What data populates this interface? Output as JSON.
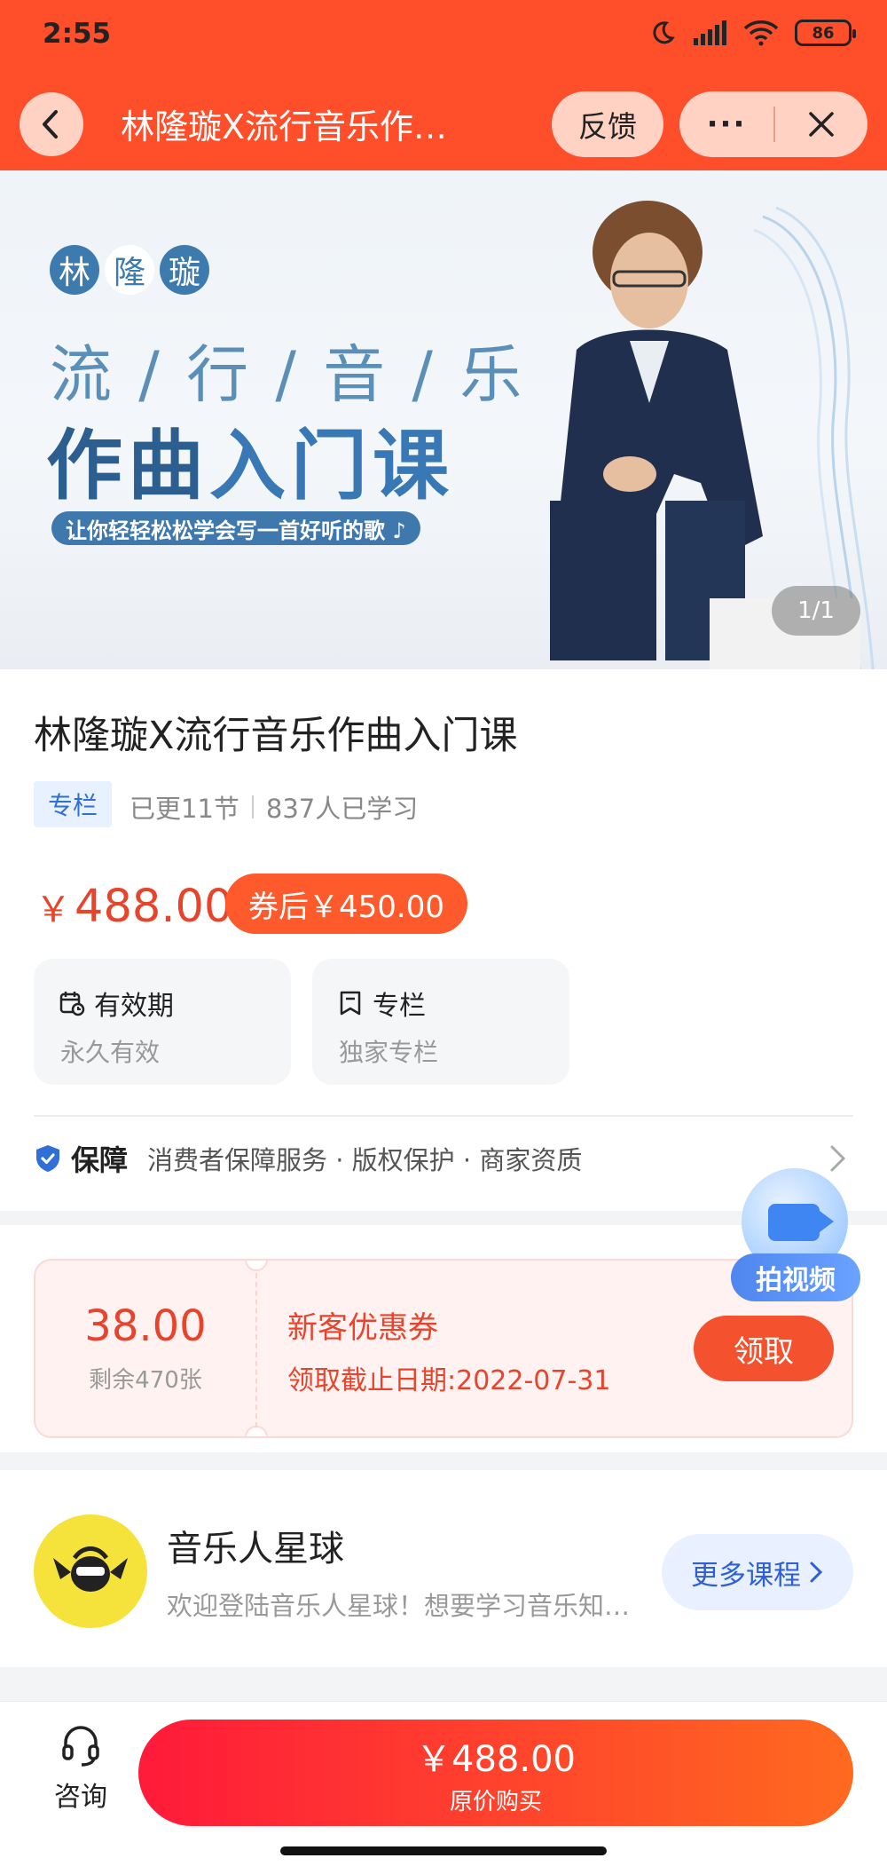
{
  "status_bar": {
    "time": "2:55",
    "battery": "86"
  },
  "nav": {
    "title": "林隆璇X流行音乐作曲入门课",
    "feedback_label": "反馈",
    "more_label": "···"
  },
  "banner": {
    "name_chars": [
      "林",
      "隆",
      "璇"
    ],
    "line1": "流 / 行 / 音 / 乐",
    "line2_a": "作曲",
    "line2_b": "入门课",
    "slogan": "让你轻轻松松学会写一首好听的歌 ♪",
    "pager": "1/1"
  },
  "course": {
    "title": "林隆璇X流行音乐作曲入门课",
    "tag": "专栏",
    "updated": "已更11节",
    "learners": "837人已学习",
    "price_symbol": "￥",
    "price": "488.00",
    "coupon_price": "券后￥450.00",
    "validity_title": "有效期",
    "validity_value": "永久有效",
    "column_title": "专栏",
    "column_value": "独家专栏",
    "guarantee_title": "保障",
    "guarantee_items": "消费者保障服务 · 版权保护 · 商家资质"
  },
  "float_button": {
    "label": "拍视频"
  },
  "coupon": {
    "amount": "38.00",
    "remaining": "剩余470张",
    "name": "新客优惠券",
    "deadline": "领取截止日期:2022-07-31",
    "claim_label": "领取"
  },
  "shop": {
    "name": "音乐人星球",
    "description": "欢迎登陆音乐人星球！想要学习音乐知识的朋友们",
    "more_label": "更多课程"
  },
  "bottom_bar": {
    "consult_label": "咨询",
    "buy_price": "￥488.00",
    "buy_sub": "原价购买"
  },
  "colors": {
    "brand_orange": "#ff4f2a",
    "price_red": "#e8432b",
    "link_blue": "#2f6fd6"
  }
}
